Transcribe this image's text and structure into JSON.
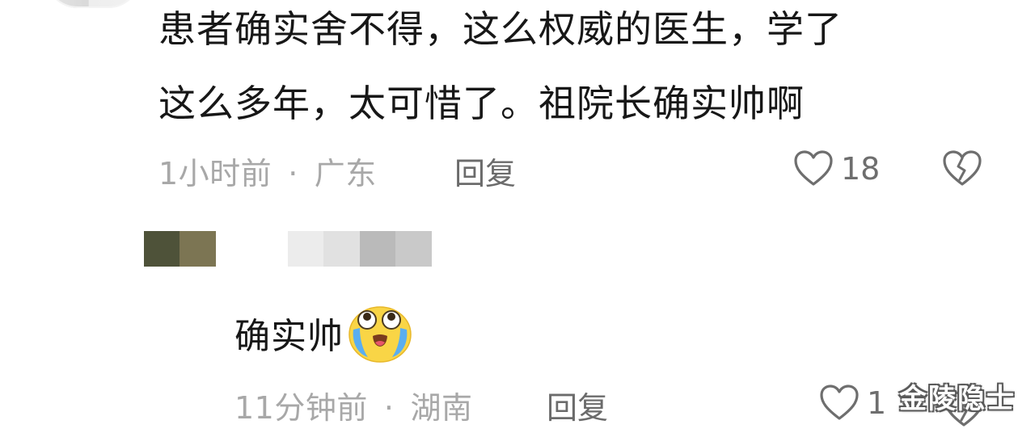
{
  "comment": {
    "text_line1": "患者确实舍不得，这么权威的医生，学了",
    "text_line2": "这么多年，太可惜了。祖院长确实帅啊",
    "time": "1小时前",
    "separator": "·",
    "location": "广东",
    "reply_label": "回复",
    "likes": "18"
  },
  "reply": {
    "text": "确实帅",
    "emoji": "crying-face-emoji",
    "time": "11分钟前",
    "separator": "·",
    "location": "湖南",
    "reply_label": "回复",
    "likes": "1"
  },
  "watermark": "金陵隐士",
  "colors": {
    "meta_text": "#a8a8a8",
    "action_text": "#6b6b6b",
    "main_text": "#171717"
  }
}
